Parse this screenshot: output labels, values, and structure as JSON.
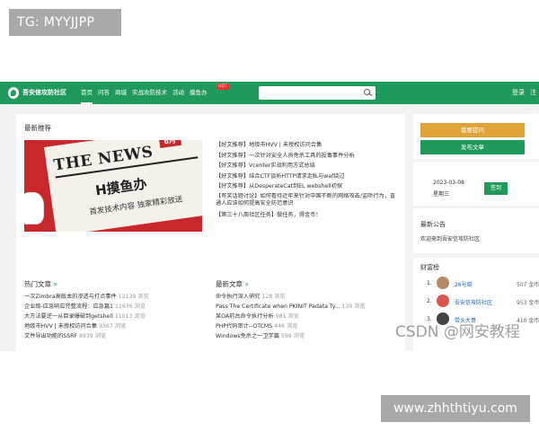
{
  "tag_top": "TG: MYYJJPP",
  "tag_bottom": "www.zhhthtiyu.com",
  "watermark": "CSDN @网安教程",
  "colors": {
    "nav": "#1f9a5c",
    "accent_orange": "#e0a33a",
    "banner_red": "#c8272b"
  },
  "nav": {
    "brand": "吾安信攻防社区",
    "items": [
      "首页",
      "问答",
      "商城",
      "实战攻防技术",
      "活动",
      "摸鱼办"
    ],
    "hot_badge": "HOT",
    "login": "登录",
    "register": "注册"
  },
  "featured": {
    "title": "最新推荐",
    "banner": {
      "headline": "THE NEWS",
      "month": "6月",
      "main": "H摸鱼办",
      "sub": "首发技术内容 独家精彩放送"
    },
    "items": [
      "【好文推荐】地级市HVV | 未授权访问合集",
      "【好文推荐】一次针对安全人员免杀工具的投毒事件分析",
      "【好文推荐】Vcenter实战利用方式总结",
      "【好文推荐】结合CTF谈析HTTP请求走私与waf绕过",
      "【好文推荐】从DesperateCat到EL webshell初探",
      "【有奖话题讨论】如何看待近年来针对中国不断的网络攻击/监听行为，普通人应该如何提高安全防范意识",
      "【第三十八周社区任务】做任务，得金币！"
    ]
  },
  "hot": {
    "title": "热门文章",
    "items": [
      {
        "title": "一次Zimbra高版本的渗透与打点事件",
        "views": "12139 浏览"
      },
      {
        "title": "企业级-应急响应完整流程：应急篇1",
        "views": "11636 浏览"
      },
      {
        "title": "大方法要逆一从目录爆破到getshell",
        "views": "11013 浏览"
      },
      {
        "title": "地级市HVV | 未授权访问合集",
        "views": "9367 浏览"
      },
      {
        "title": "文件导出功能的SSRF",
        "views": "8939 浏览"
      }
    ]
  },
  "latest": {
    "title": "最新文章",
    "items": [
      {
        "title": "命令执行深入研究",
        "views": "128 浏览"
      },
      {
        "title": "Pass The Certificate when PKINIT Padata Ty...",
        "views": "139 浏览"
      },
      {
        "title": "某OA前台命令执行分析",
        "views": "981 浏览"
      },
      {
        "title": "PHP代码审计--OTCMS",
        "views": "446 浏览"
      },
      {
        "title": "Windows免杀之一卫学篇",
        "views": "599 浏览"
      }
    ]
  },
  "right": {
    "btn_orange": "我要提问",
    "btn_green": "发布文章",
    "date": "2023-03-08",
    "weekday": "星期三",
    "signin": "签到",
    "notice_title": "最新公告",
    "notice_text": "欢迎来到吾安信攻防社区",
    "rank_title": "财富榜",
    "ranks": [
      {
        "n": "1.",
        "name": "26号晓",
        "coins": "507 金币"
      },
      {
        "n": "2.",
        "name": "吾安信攻防社区",
        "coins": "953 金币"
      },
      {
        "n": "3.",
        "name": "带头大哥",
        "coins": "410 金币"
      }
    ]
  }
}
